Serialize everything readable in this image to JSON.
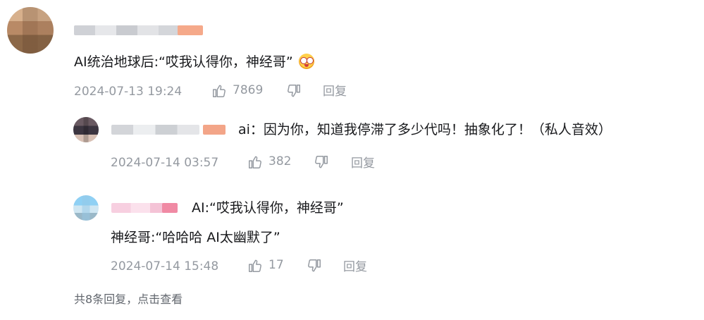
{
  "main_comment": {
    "text": "AI统治地球后:“哎我认得你，神经哥”",
    "emoji": "surprised-glasses-emoji",
    "time": "2024-07-13 19:24",
    "likes": "7869",
    "reply_label": "回复"
  },
  "replies": [
    {
      "text": "ai：因为你，知道我停滞了多少代吗！抽象化了！（私人音效）",
      "time": "2024-07-14 03:57",
      "likes": "382",
      "reply_label": "回复"
    },
    {
      "line1": "AI:“哎我认得你，神经哥”",
      "line2": "神经哥:“哈哈哈 AI太幽默了”",
      "time": "2024-07-14 15:48",
      "likes": "17",
      "reply_label": "回复"
    }
  ],
  "more_replies": "共8条回复，点击查看",
  "colors": {
    "text": "#18191c",
    "meta": "#9499a0"
  }
}
